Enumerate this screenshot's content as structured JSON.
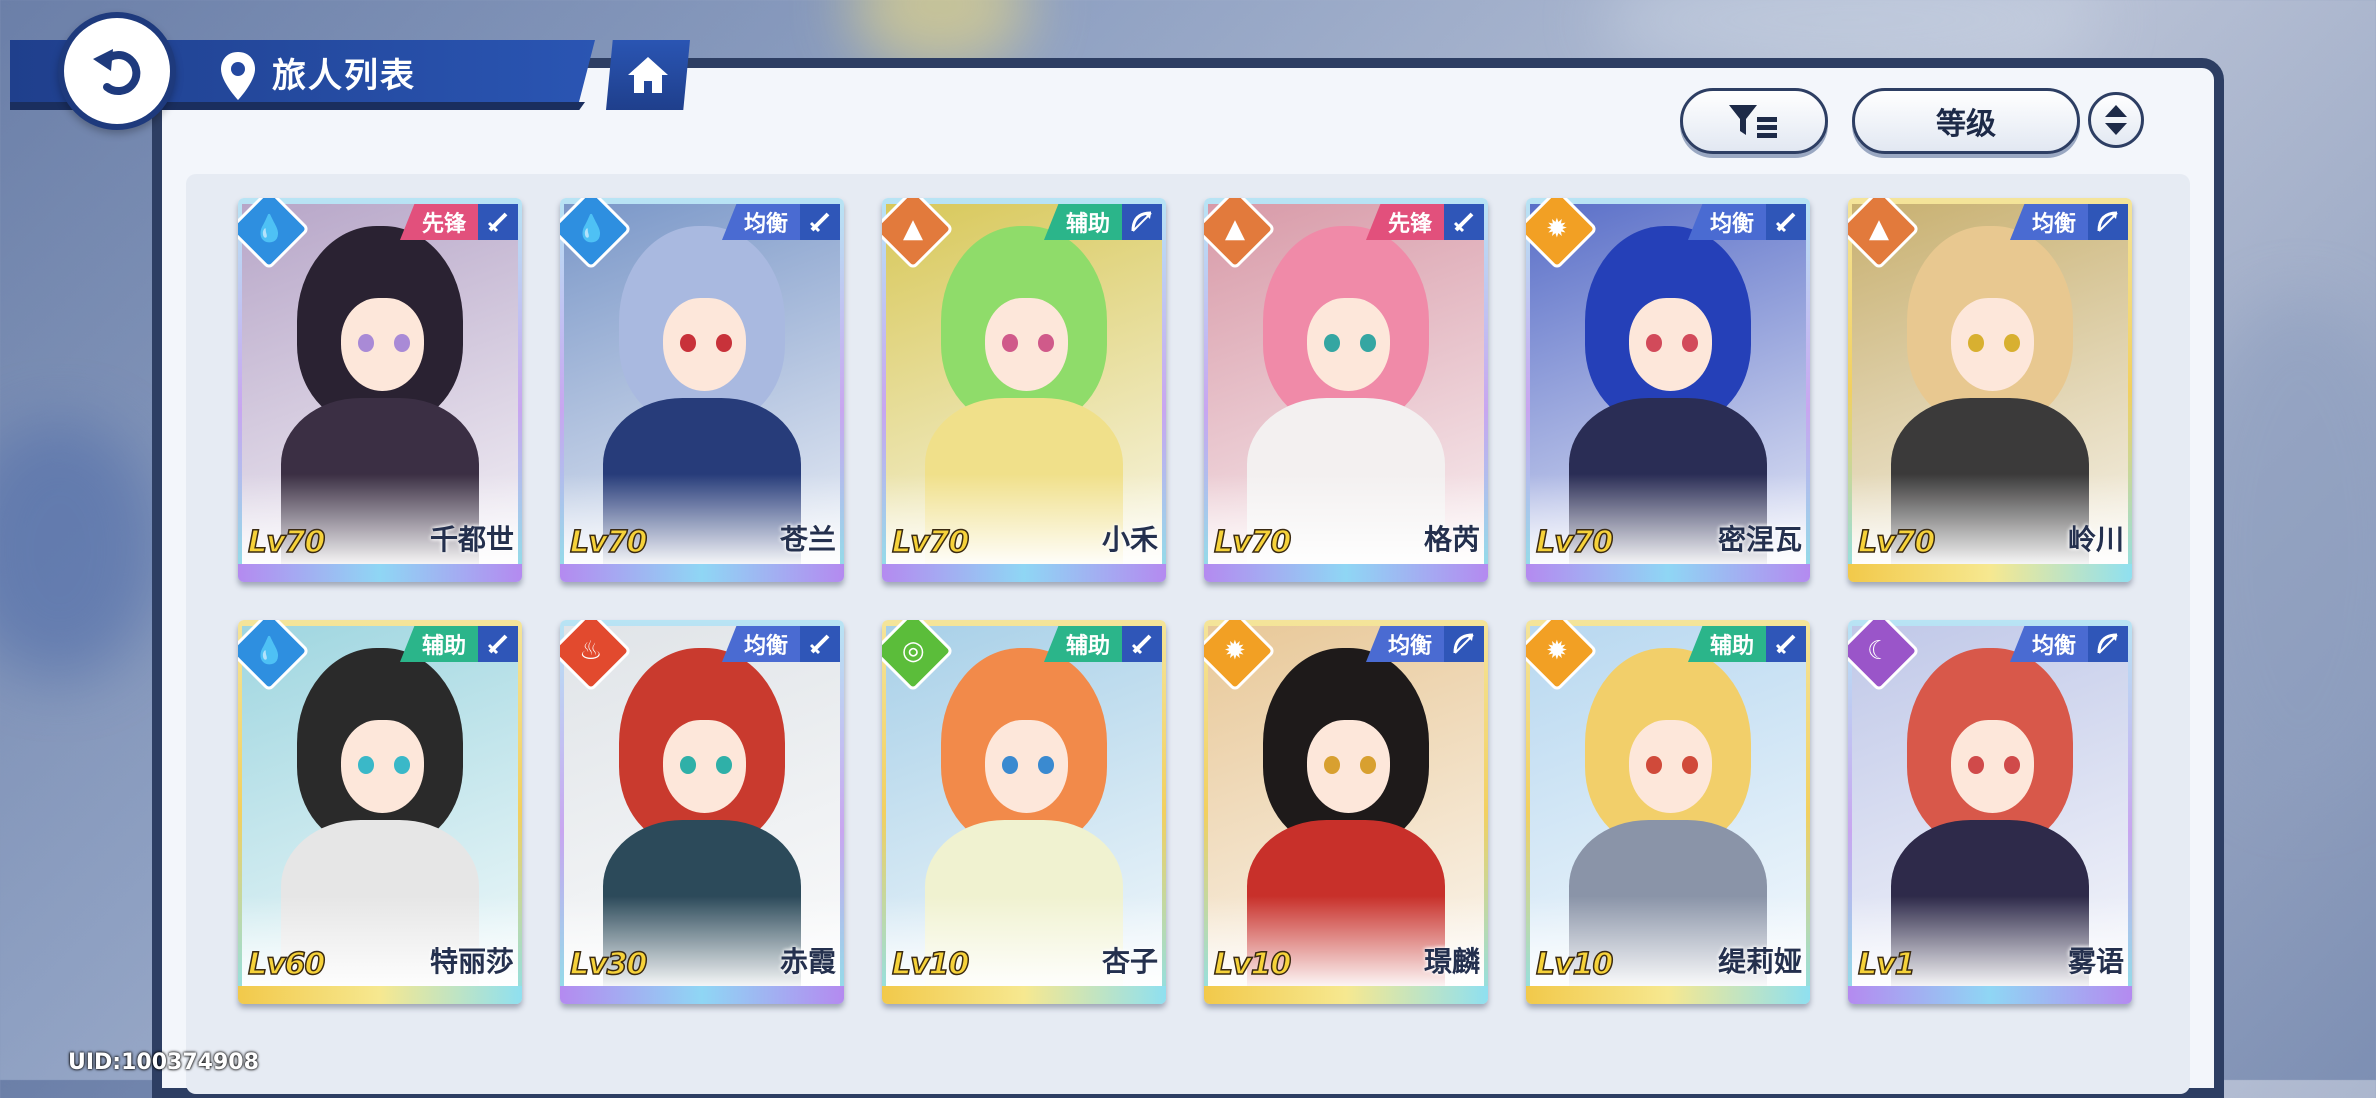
{
  "header": {
    "title": "旅人列表"
  },
  "toolbar": {
    "filter_icon": "filter-list-icon",
    "sort_label": "等级",
    "order_icon": "sort-toggle-icon"
  },
  "colors": {
    "role_vanguard": "#e2507c",
    "role_balance": "#4a6bd2",
    "role_support": "#2bb58a",
    "elem_water": "#2e8fe0",
    "elem_earth": "#e27a3c",
    "elem_light": "#f2a024",
    "elem_fire": "#e24a2e",
    "elem_wind": "#5bbd3a",
    "elem_dark": "#9a55c9"
  },
  "cards": [
    {
      "level": "Lv70",
      "name": "千都世",
      "role": "先锋",
      "element": "water",
      "weapon": "sword",
      "frame": "purple",
      "hair": "#2a2232",
      "body": "#3b2f44",
      "eyes": "#a98ad6",
      "bg": "#b7a6c8"
    },
    {
      "level": "Lv70",
      "name": "苍兰",
      "role": "均衡",
      "element": "water",
      "weapon": "sword",
      "frame": "purple",
      "hair": "#a9b9e0",
      "body": "#273c7a",
      "eyes": "#c8323a",
      "bg": "#7a97c8"
    },
    {
      "level": "Lv70",
      "name": "小禾",
      "role": "辅助",
      "element": "earth",
      "weapon": "bow",
      "frame": "purple",
      "hair": "#8fdc6a",
      "body": "#f0e08a",
      "eyes": "#d05a8a",
      "bg": "#d8c85a"
    },
    {
      "level": "Lv70",
      "name": "格芮",
      "role": "先锋",
      "element": "earth",
      "weapon": "sword",
      "frame": "purple",
      "hair": "#f08aa8",
      "body": "#f3f0f0",
      "eyes": "#35a6a2",
      "bg": "#d89aa8"
    },
    {
      "level": "Lv70",
      "name": "密涅瓦",
      "role": "均衡",
      "element": "light",
      "weapon": "sword",
      "frame": "purple",
      "hair": "#2540b8",
      "body": "#2a2d55",
      "eyes": "#d24a5a",
      "bg": "#5a6fc8"
    },
    {
      "level": "Lv70",
      "name": "岭川",
      "role": "均衡",
      "element": "earth",
      "weapon": "bow",
      "frame": "gold",
      "hair": "#e8c890",
      "body": "#3b3a3a",
      "eyes": "#d8b030",
      "bg": "#c8b070"
    },
    {
      "level": "Lv60",
      "name": "特丽莎",
      "role": "辅助",
      "element": "water",
      "weapon": "sword",
      "frame": "gold",
      "hair": "#2a2a2a",
      "body": "#e6e6e6",
      "eyes": "#3ab8c8",
      "bg": "#9fd6e0"
    },
    {
      "level": "Lv30",
      "name": "赤霞",
      "role": "均衡",
      "element": "fire",
      "weapon": "sword",
      "frame": "purple",
      "hair": "#c93a2e",
      "body": "#2c4a5a",
      "eyes": "#2fb0a8",
      "bg": "#e0e4e8"
    },
    {
      "level": "Lv10",
      "name": "杏子",
      "role": "辅助",
      "element": "wind",
      "weapon": "sword",
      "frame": "gold",
      "hair": "#f28a4a",
      "body": "#f0f2d0",
      "eyes": "#3a8ad0",
      "bg": "#a8d0e8"
    },
    {
      "level": "Lv10",
      "name": "璟麟",
      "role": "均衡",
      "element": "light",
      "weapon": "bow",
      "frame": "gold",
      "hair": "#1e1a1a",
      "body": "#c8302a",
      "eyes": "#d8a030",
      "bg": "#e8c898"
    },
    {
      "level": "Lv10",
      "name": "缇莉娅",
      "role": "辅助",
      "element": "light",
      "weapon": "sword",
      "frame": "gold",
      "hair": "#f2cf6a",
      "body": "#8a94a8",
      "eyes": "#d04a3a",
      "bg": "#b8d8f0"
    },
    {
      "level": "Lv1",
      "name": "雾语",
      "role": "均衡",
      "element": "dark",
      "weapon": "bow",
      "frame": "purple",
      "hair": "#d8584a",
      "body": "#2e2a4a",
      "eyes": "#d04a4a",
      "bg": "#c0c8e8"
    }
  ],
  "footer": {
    "uid": "UID:100374908"
  }
}
